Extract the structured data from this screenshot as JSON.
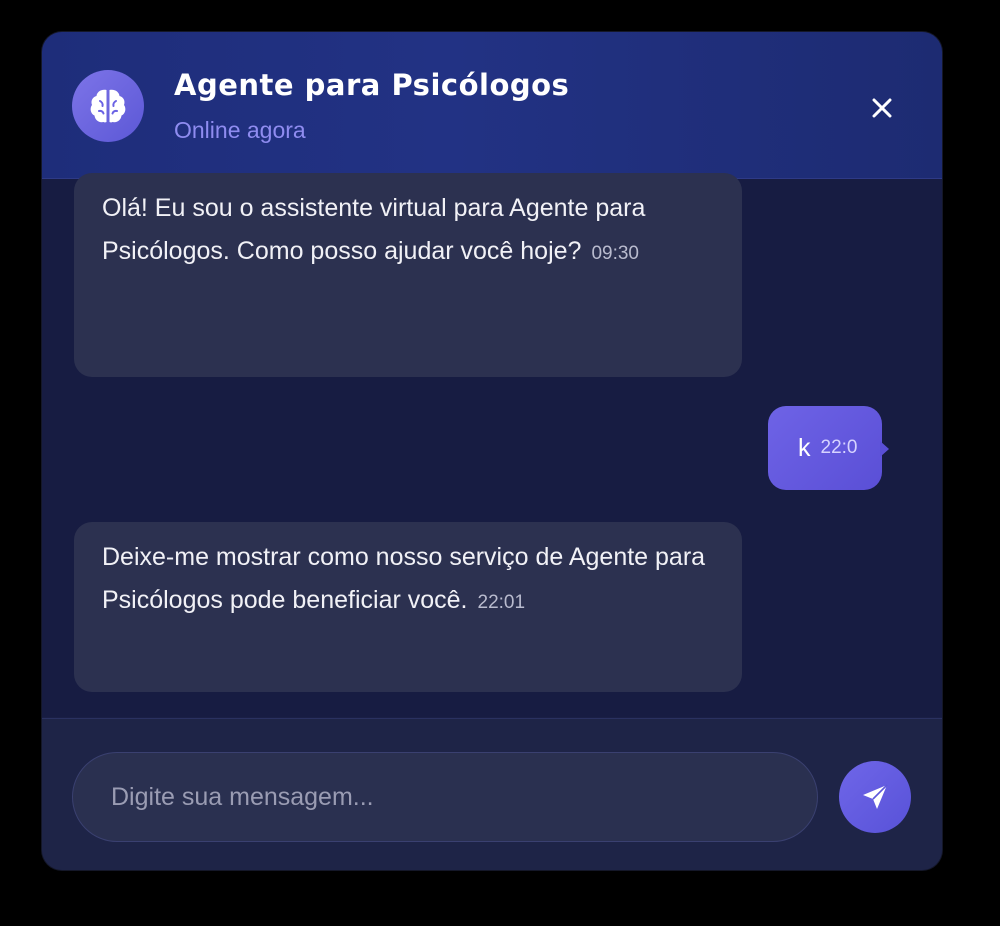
{
  "header": {
    "title": "Agente para Psicólogos",
    "status": "Online agora",
    "avatar_icon": "brain-icon",
    "close_icon": "close-icon"
  },
  "messages": [
    {
      "sender": "bot",
      "text": "Olá! Eu sou o assistente virtual para Agente para Psicólogos. Como posso ajudar você hoje?",
      "time": "09:30"
    },
    {
      "sender": "user",
      "text": "k",
      "time": "22:0"
    },
    {
      "sender": "bot",
      "text": "Deixe-me mostrar como nosso serviço de Agente para Psicólogos pode beneficiar você.",
      "time": "22:01"
    }
  ],
  "composer": {
    "placeholder": "Digite sua mensagem...",
    "value": "",
    "send_icon": "send-icon"
  },
  "colors": {
    "accent": "#6a62e4",
    "header_bg": "#1f2e7c",
    "window_bg": "#171c42",
    "bot_bubble": "#2c3150",
    "status_text": "#8f8cf0"
  }
}
